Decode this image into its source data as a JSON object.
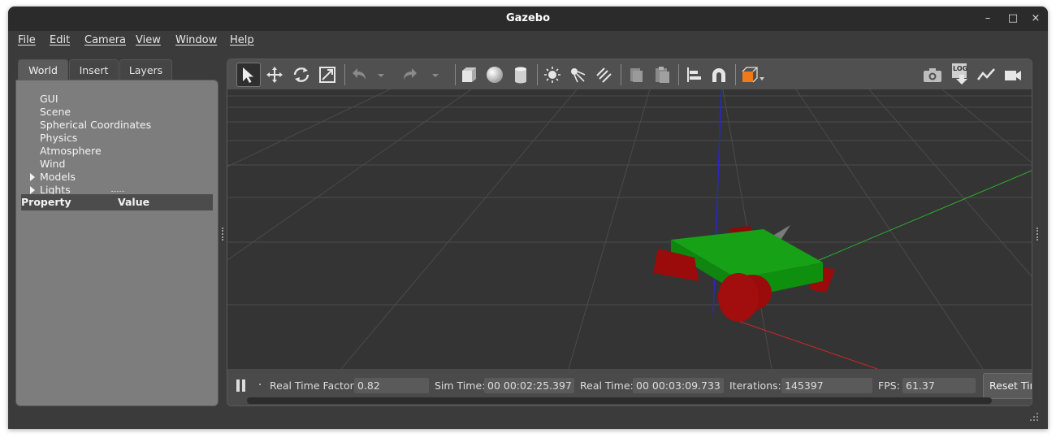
{
  "window": {
    "title": "Gazebo",
    "controls": [
      "–",
      "□",
      "×"
    ]
  },
  "menubar": [
    "File",
    "Edit",
    "Camera",
    "View",
    "Window",
    "Help"
  ],
  "left_panel": {
    "tabs": [
      "World",
      "Insert",
      "Layers"
    ],
    "active_tab": "World",
    "tree": [
      {
        "label": "GUI",
        "expandable": false
      },
      {
        "label": "Scene",
        "expandable": false
      },
      {
        "label": "Spherical Coordinates",
        "expandable": false
      },
      {
        "label": "Physics",
        "expandable": false
      },
      {
        "label": "Atmosphere",
        "expandable": false
      },
      {
        "label": "Wind",
        "expandable": false
      },
      {
        "label": "Models",
        "expandable": true
      },
      {
        "label": "Lights",
        "expandable": true
      }
    ],
    "property_header": {
      "property": "Property",
      "value": "Value"
    }
  },
  "toolbar": {
    "icons": [
      "select-arrow-icon",
      "translate-icon",
      "rotate-icon",
      "scale-icon",
      "undo-icon",
      "undo-dropdown-icon",
      "redo-icon",
      "redo-dropdown-icon",
      "box-shape-icon",
      "sphere-shape-icon",
      "cylinder-shape-icon",
      "point-light-icon",
      "spot-light-icon",
      "directional-light-icon",
      "copy-icon",
      "paste-icon",
      "align-icon",
      "snap-magnet-icon",
      "view-angle-icon",
      "screenshot-icon",
      "log-icon",
      "plot-icon",
      "video-record-icon"
    ],
    "log_text": "LOG"
  },
  "colors": {
    "chassis": "#17a117",
    "wheel": "#9b0b0b",
    "x_axis": "#c82828",
    "y_axis": "#2db02d",
    "z_axis": "#2828c8",
    "orange_accent": "#f07a16"
  },
  "status": {
    "real_time_factor_label": "Real Time Factor:",
    "real_time_factor": "0.82",
    "sim_time_label": "Sim Time:",
    "sim_time": "00 00:02:25.397",
    "real_time_label": "Real Time:",
    "real_time": "00 00:03:09.733",
    "iterations_label": "Iterations:",
    "iterations": "145397",
    "fps_label": "FPS:",
    "fps": "61.37",
    "reset_label": "Reset Time"
  }
}
